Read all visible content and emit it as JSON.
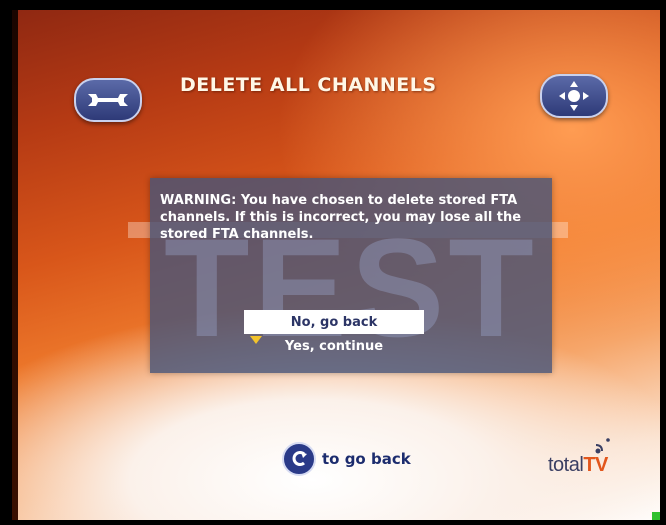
{
  "header": {
    "title": "DELETE ALL CHANNELS",
    "left_icon": "wrench-icon",
    "right_icon": "navigation-pad-icon"
  },
  "dialog": {
    "warning": "WARNING: You have chosen to delete stored FTA channels. If this is incorrect, you may lose all the stored FTA channels.",
    "watermark": "TEST",
    "options": [
      {
        "label": "No, go back",
        "selected": true
      },
      {
        "label": "Yes, continue",
        "selected": false
      }
    ]
  },
  "footer": {
    "hint_icon": "back-button-icon",
    "hint_label": "to go back",
    "logo_text_a": "total",
    "logo_text_b": "TV"
  },
  "colors": {
    "title": "#fff7e6",
    "dialog_bg": "#485478",
    "selected_bg": "#ffffff",
    "arrow": "#f2c32b",
    "logo_accent": "#e2561c"
  }
}
